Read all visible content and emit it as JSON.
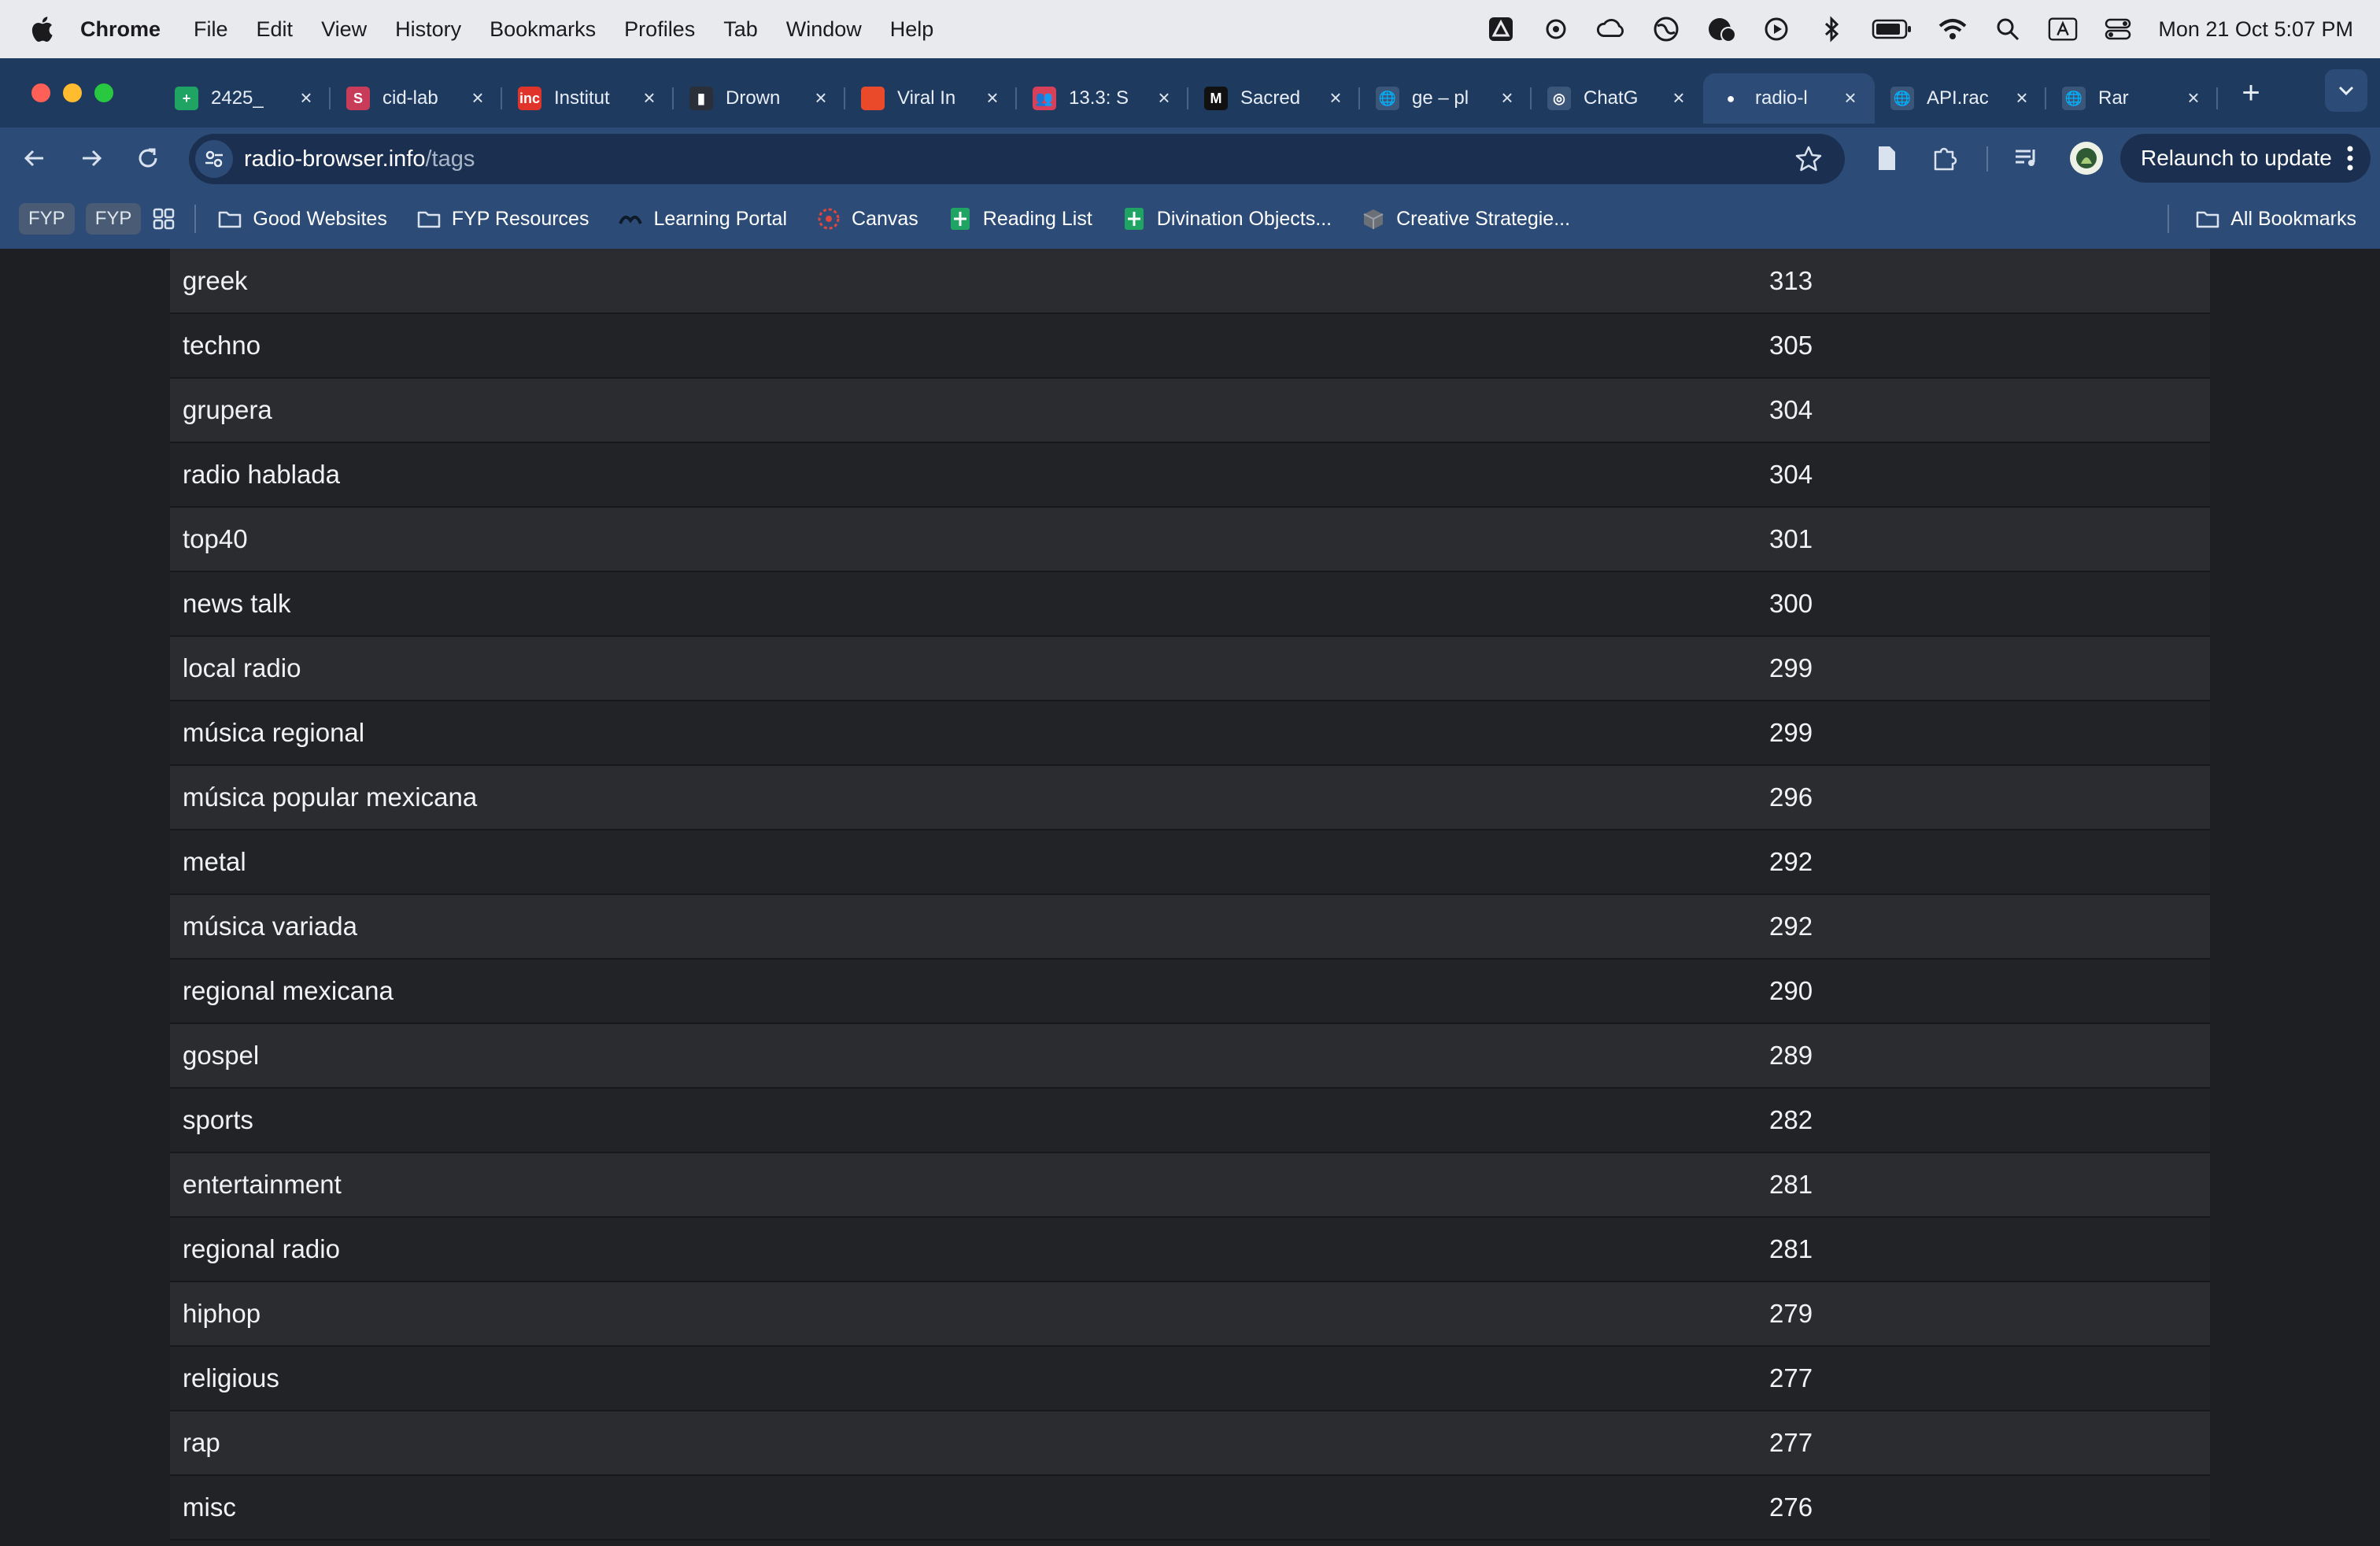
{
  "menubar": {
    "app_name": "Chrome",
    "menus": [
      "File",
      "Edit",
      "View",
      "History",
      "Bookmarks",
      "Profiles",
      "Tab",
      "Window",
      "Help"
    ],
    "clock": "Mon 21 Oct  5:07 PM"
  },
  "tabs": [
    {
      "title": "2425_",
      "favicon_color": "#1fa463",
      "favicon_glyph": "+"
    },
    {
      "title": "cid-lab",
      "favicon_color": "#c83c5a",
      "favicon_glyph": "S"
    },
    {
      "title": "Institut",
      "favicon_color": "#e0342a",
      "favicon_glyph": "inc"
    },
    {
      "title": "Drown",
      "favicon_color": "#2a2f3a",
      "favicon_glyph": "▮"
    },
    {
      "title": "Viral In",
      "favicon_color": "#ea4a2a",
      "favicon_glyph": ""
    },
    {
      "title": "13.3: S",
      "favicon_color": "#d8405a",
      "favicon_glyph": "👥"
    },
    {
      "title": "Sacred",
      "favicon_color": "#111111",
      "favicon_glyph": "M"
    },
    {
      "title": "ge – pl",
      "favicon_color": "#3b5679",
      "favicon_glyph": "🌐"
    },
    {
      "title": "ChatG",
      "favicon_color": "#3b5679",
      "favicon_glyph": "◎"
    },
    {
      "title": "radio-l",
      "favicon_color": "#2c4c77",
      "favicon_glyph": "●",
      "active": true
    },
    {
      "title": "API.rac",
      "favicon_color": "#3b5679",
      "favicon_glyph": "🌐"
    },
    {
      "title": "Rar",
      "favicon_color": "#3b5679",
      "favicon_glyph": "🌐"
    }
  ],
  "toolbar": {
    "url_host": "radio-browser.info",
    "url_path": "/tags",
    "relaunch_label": "Relaunch to update"
  },
  "bookmarks": {
    "chips": [
      "FYP",
      "FYP"
    ],
    "items": [
      {
        "label": "Good Websites",
        "icon": "folder-icon"
      },
      {
        "label": "FYP Resources",
        "icon": "folder-icon"
      },
      {
        "label": "Learning Portal",
        "icon": "learning-portal-icon"
      },
      {
        "label": "Canvas",
        "icon": "canvas-icon"
      },
      {
        "label": "Reading List",
        "icon": "sheets-icon"
      },
      {
        "label": "Divination Objects...",
        "icon": "sheets-icon"
      },
      {
        "label": "Creative Strategie...",
        "icon": "cube-icon"
      }
    ],
    "all_bookmarks": "All Bookmarks"
  },
  "tags": [
    {
      "name": "greek",
      "count": "313"
    },
    {
      "name": "techno",
      "count": "305"
    },
    {
      "name": "grupera",
      "count": "304"
    },
    {
      "name": "radio hablada",
      "count": "304"
    },
    {
      "name": "top40",
      "count": "301"
    },
    {
      "name": "news talk",
      "count": "300"
    },
    {
      "name": "local radio",
      "count": "299"
    },
    {
      "name": "música regional",
      "count": "299"
    },
    {
      "name": "música popular mexicana",
      "count": "296"
    },
    {
      "name": "metal",
      "count": "292"
    },
    {
      "name": "música variada",
      "count": "292"
    },
    {
      "name": "regional mexicana",
      "count": "290"
    },
    {
      "name": "gospel",
      "count": "289"
    },
    {
      "name": "sports",
      "count": "282"
    },
    {
      "name": "entertainment",
      "count": "281"
    },
    {
      "name": "regional radio",
      "count": "281"
    },
    {
      "name": "hiphop",
      "count": "279"
    },
    {
      "name": "religious",
      "count": "277"
    },
    {
      "name": "rap",
      "count": "277"
    },
    {
      "name": "misc",
      "count": "276"
    }
  ]
}
